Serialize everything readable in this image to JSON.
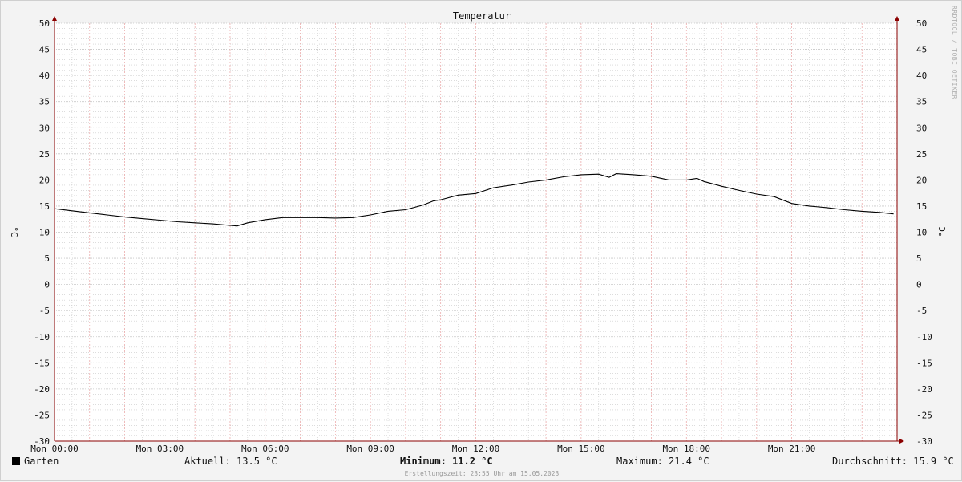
{
  "watermark": "RRDTOOL / TOBI OETIKER",
  "legend": {
    "series_name": "Garten",
    "current": "Aktuell: 13.5 °C",
    "min_label": "Minimum:",
    "min_value": "11.2 °C",
    "max": "Maximum: 21.4 °C",
    "avg": "Durchschnitt: 15.9 °C"
  },
  "footer": "Erstellungszeit: 23:55 Uhr am 15.05.2023",
  "colors": {
    "line": "#000000",
    "major_grid": "#e8a0a0",
    "minor_grid": "#c8c8c8",
    "axis": "#8b0000"
  },
  "chart_data": {
    "type": "line",
    "title": "Temperatur",
    "ylabel": "°C",
    "ylabel_right": "°C",
    "xlim": [
      0,
      24
    ],
    "ylim": [
      -30,
      50
    ],
    "grid": true,
    "y_ticks": [
      50,
      45,
      40,
      35,
      30,
      25,
      20,
      15,
      10,
      5,
      0,
      -5,
      -10,
      -15,
      -20,
      -25,
      -30
    ],
    "x_ticks": [
      {
        "x": 0,
        "label": "Mon 00:00"
      },
      {
        "x": 3,
        "label": "Mon 03:00"
      },
      {
        "x": 6,
        "label": "Mon 06:00"
      },
      {
        "x": 9,
        "label": "Mon 09:00"
      },
      {
        "x": 12,
        "label": "Mon 12:00"
      },
      {
        "x": 15,
        "label": "Mon 15:00"
      },
      {
        "x": 18,
        "label": "Mon 18:00"
      },
      {
        "x": 21,
        "label": "Mon 21:00"
      }
    ],
    "series": [
      {
        "name": "Garten",
        "x": [
          0,
          0.5,
          1,
          1.5,
          2,
          2.5,
          3,
          3.5,
          4,
          4.5,
          5,
          5.2,
          5.5,
          6,
          6.5,
          7,
          7.5,
          8,
          8.5,
          9,
          9.5,
          10,
          10.5,
          10.8,
          11,
          11.5,
          12,
          12.5,
          13,
          13.5,
          14,
          14.5,
          15,
          15.5,
          15.8,
          16,
          16.5,
          17,
          17.5,
          18,
          18.3,
          18.5,
          19,
          19.5,
          20,
          20.5,
          21,
          21.5,
          22,
          22.5,
          23,
          23.5,
          23.9
        ],
        "y": [
          14.5,
          14.1,
          13.7,
          13.3,
          12.9,
          12.6,
          12.3,
          12.0,
          11.8,
          11.6,
          11.3,
          11.2,
          11.8,
          12.4,
          12.8,
          12.8,
          12.8,
          12.7,
          12.8,
          13.3,
          14.0,
          14.3,
          15.2,
          16.0,
          16.2,
          17.1,
          17.4,
          18.5,
          19.0,
          19.6,
          20.0,
          20.6,
          21.0,
          21.1,
          20.5,
          21.2,
          21.0,
          20.7,
          20.0,
          20.0,
          20.3,
          19.7,
          18.8,
          18.0,
          17.3,
          16.8,
          15.5,
          15.0,
          14.7,
          14.3,
          14.0,
          13.8,
          13.5
        ]
      }
    ]
  }
}
